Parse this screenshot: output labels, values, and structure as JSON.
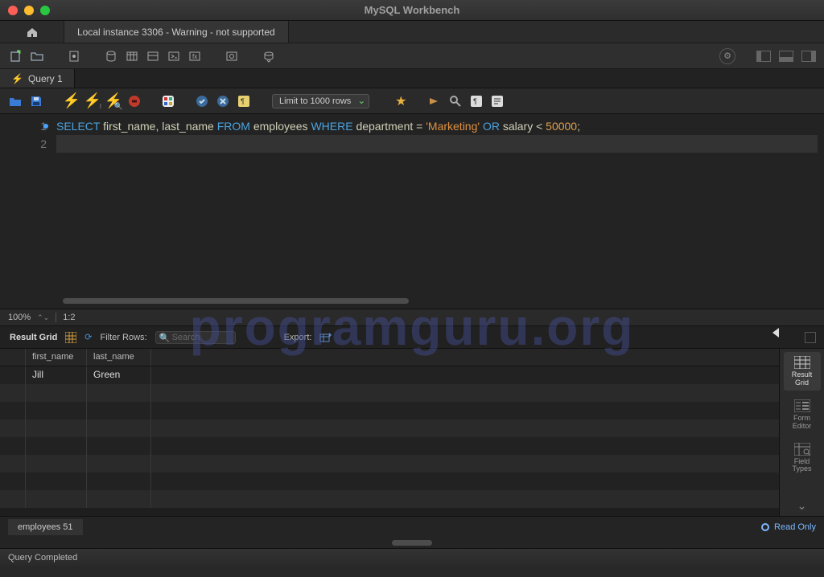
{
  "window": {
    "title": "MySQL Workbench"
  },
  "connection_tab": "Local instance 3306 - Warning - not supported",
  "query_tab": "Query 1",
  "limit_dropdown": "Limit to 1000 rows",
  "sql": {
    "line1_html": true,
    "tokens": [
      {
        "t": "SELECT",
        "c": "kw"
      },
      {
        "t": " first_name, last_name ",
        "c": ""
      },
      {
        "t": "FROM",
        "c": "kw"
      },
      {
        "t": " employees ",
        "c": ""
      },
      {
        "t": "WHERE",
        "c": "kw"
      },
      {
        "t": " department = ",
        "c": ""
      },
      {
        "t": "'Marketing'",
        "c": "str"
      },
      {
        "t": " ",
        "c": ""
      },
      {
        "t": "OR",
        "c": "kw"
      },
      {
        "t": " salary < ",
        "c": ""
      },
      {
        "t": "50000",
        "c": "num"
      },
      {
        "t": ";",
        "c": ""
      }
    ]
  },
  "zoom": {
    "pct": "100%",
    "pos": "1:2"
  },
  "result_toolbar": {
    "title": "Result Grid",
    "filter_label": "Filter Rows:",
    "search_placeholder": "Search",
    "export_label": "Export:"
  },
  "columns": [
    {
      "name": "first_name",
      "width": 76
    },
    {
      "name": "last_name",
      "width": 80
    }
  ],
  "rows": [
    {
      "first_name": "Jill",
      "last_name": "Green"
    }
  ],
  "side_panel": {
    "result_grid": "Result\nGrid",
    "form_editor": "Form\nEditor",
    "field_types": "Field\nTypes"
  },
  "bottom_tab": "employees 51",
  "read_only": "Read Only",
  "footer_status": "Query Completed",
  "watermark": "programguru.org"
}
